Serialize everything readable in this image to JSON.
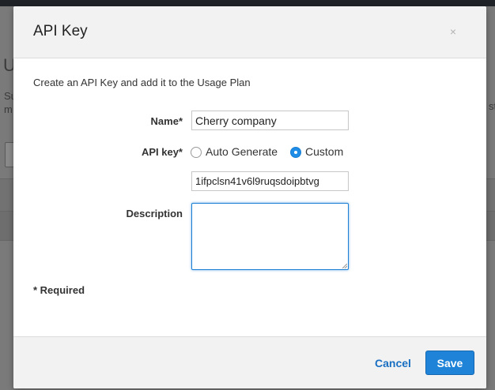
{
  "background": {
    "title_fragment": "U",
    "text_fragment_1": "Su",
    "text_fragment_2": "m",
    "text_fragment_3": "sti"
  },
  "modal": {
    "title": "API Key",
    "close_glyph": "×",
    "intro": "Create an API Key and add it to the Usage Plan",
    "fields": {
      "name_label": "Name*",
      "name_value": "Cherry company",
      "apikey_label": "API key*",
      "apikey_options": [
        "Auto Generate",
        "Custom"
      ],
      "apikey_selected": "Custom",
      "apikey_value": "1ifpclsn41v6l9ruqsdoipbtvg",
      "description_label": "Description",
      "description_value": ""
    },
    "required_note": "* Required",
    "footer": {
      "cancel_label": "Cancel",
      "save_label": "Save"
    }
  },
  "colors": {
    "accent": "#1f83d8",
    "link": "#1a6fc2"
  }
}
